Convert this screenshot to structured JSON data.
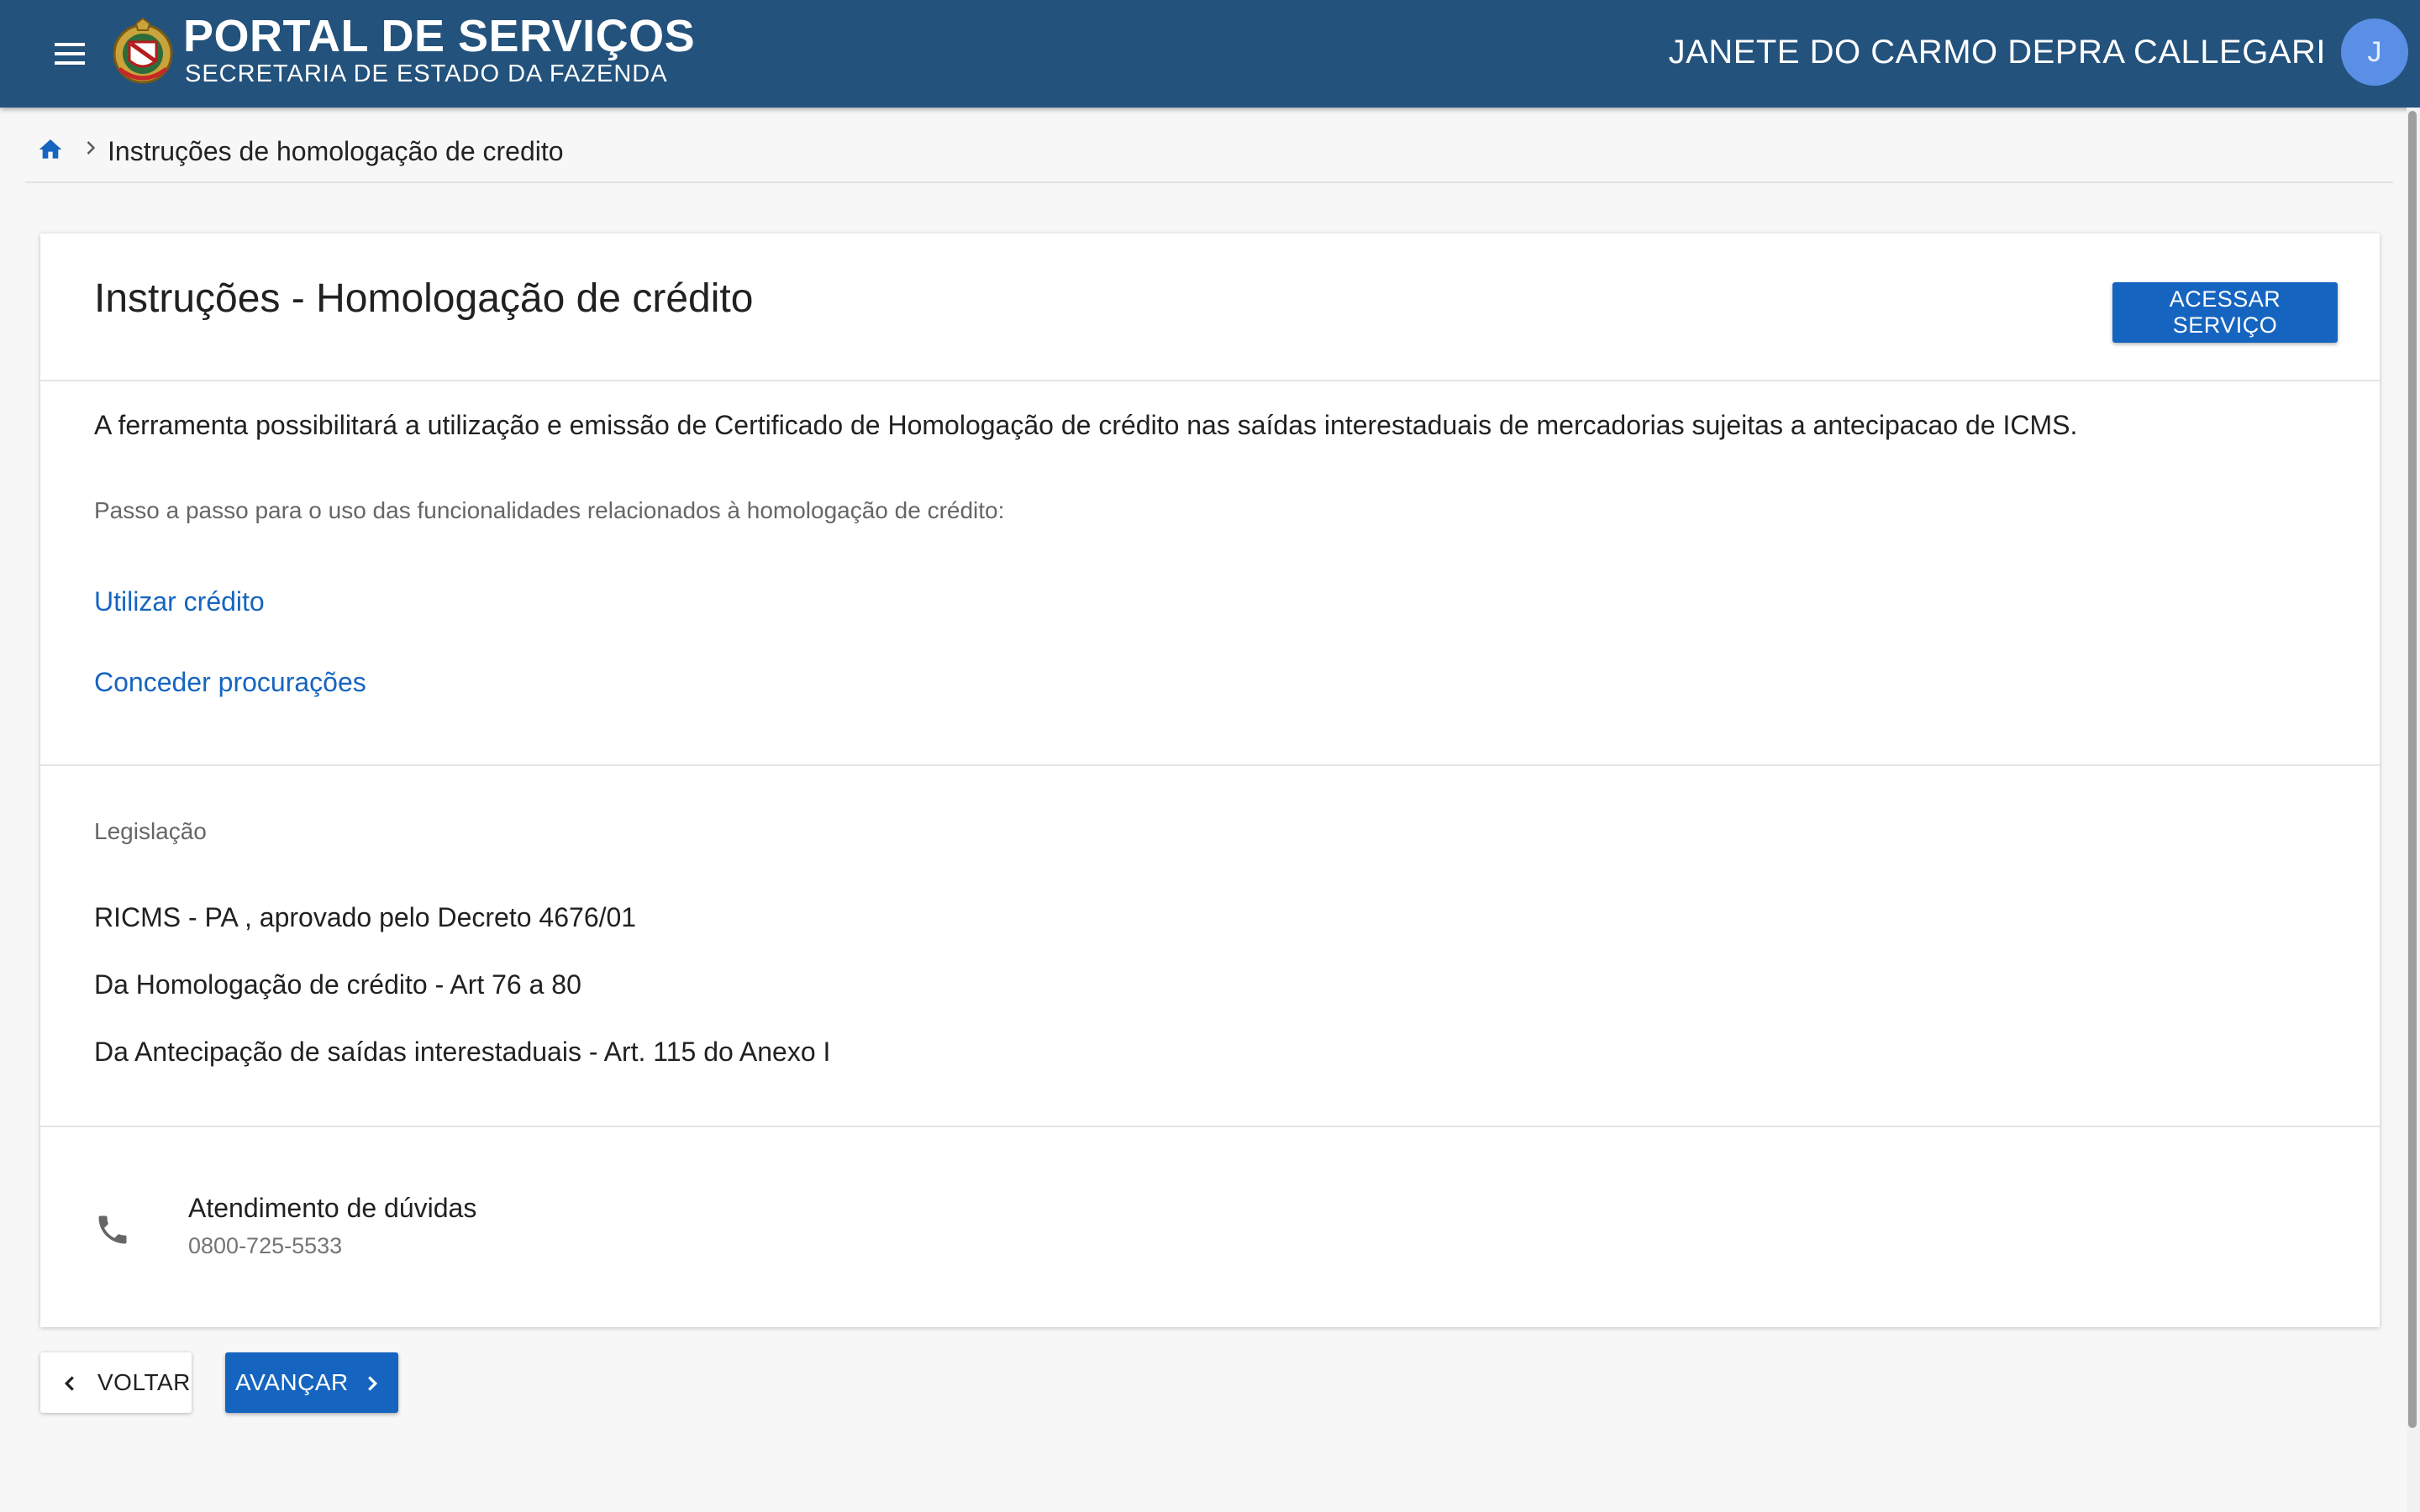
{
  "header": {
    "title": "PORTAL DE SERVIÇOS",
    "subtitle": "SECRETARIA DE ESTADO DA FAZENDA",
    "user_name": "JANETE DO CARMO DEPRA CALLEGARI",
    "avatar_initial": "J",
    "icons": {
      "menu": "menu-icon",
      "logo": "coat-of-arms-logo"
    },
    "background_color": "#23527c"
  },
  "breadcrumb": {
    "home_icon": "home-icon",
    "separator_icon": "chevron-right-icon",
    "current": "Instruções de homologação de credito"
  },
  "card": {
    "title": "Instruções - Homologação de crédito",
    "access_button_label": "ACESSAR SERVIÇO",
    "description": "A ferramenta possibilitará a utilização e emissão de Certificado de Homologação de crédito nas saídas interestaduais de mercadorias sujeitas a antecipacao de ICMS.",
    "steps_label": "Passo a passo para o uso das funcionalidades relacionados à homologação de crédito:",
    "links": [
      "Utilizar crédito",
      "Conceder procurações"
    ],
    "legislation": {
      "label": "Legislação",
      "items": [
        "RICMS - PA , aprovado pelo Decreto 4676/01",
        "Da Homologação de crédito - Art 76 a 80",
        "Da Antecipação de saídas interestaduais - Art. 115 do Anexo I"
      ]
    },
    "contact": {
      "icon": "phone-icon",
      "title": "Atendimento de dúvidas",
      "phone": "0800-725-5533"
    }
  },
  "navigation": {
    "back_label": "VOLTAR",
    "next_label": "AVANÇAR"
  },
  "colors": {
    "primary": "#1565c0",
    "header": "#23527c",
    "avatar": "#5b8fe6"
  }
}
